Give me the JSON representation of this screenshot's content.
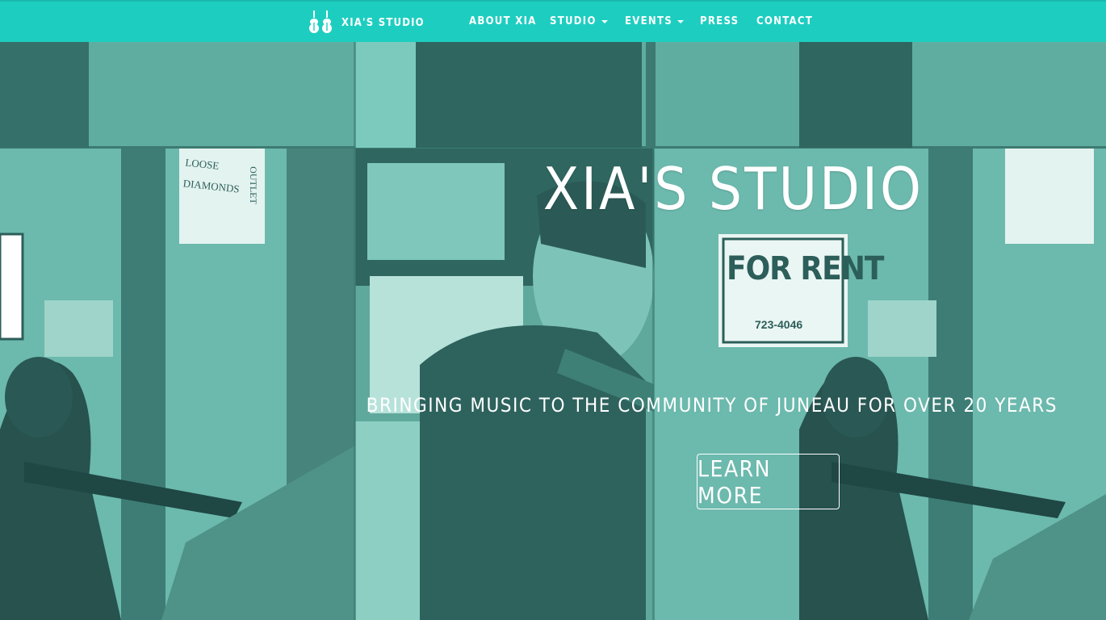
{
  "nav": {
    "brand": "XIA'S STUDIO",
    "items": [
      {
        "label": "ABOUT XIA",
        "dropdown": false
      },
      {
        "label": "STUDIO",
        "dropdown": true
      },
      {
        "label": "EVENTS",
        "dropdown": true
      },
      {
        "label": "PRESS",
        "dropdown": false
      },
      {
        "label": "CONTACT",
        "dropdown": false
      }
    ]
  },
  "hero": {
    "title": "XIA'S STUDIO",
    "subtitle": "BRINGING MUSIC TO THE COMMUNITY OF JUNEAU FOR OVER 20 YEARS",
    "button": "LEARN MORE",
    "photo_signs": {
      "for_rent": "FOR RENT",
      "phone": "723-4046",
      "left_sign": "LOOSE DIAMONDS",
      "outlet": "OUTLET"
    }
  },
  "colors": {
    "nav_bg": "#1dcec0",
    "tint_light": "#6fbcb0",
    "tint_dark": "#2c5e5a"
  }
}
